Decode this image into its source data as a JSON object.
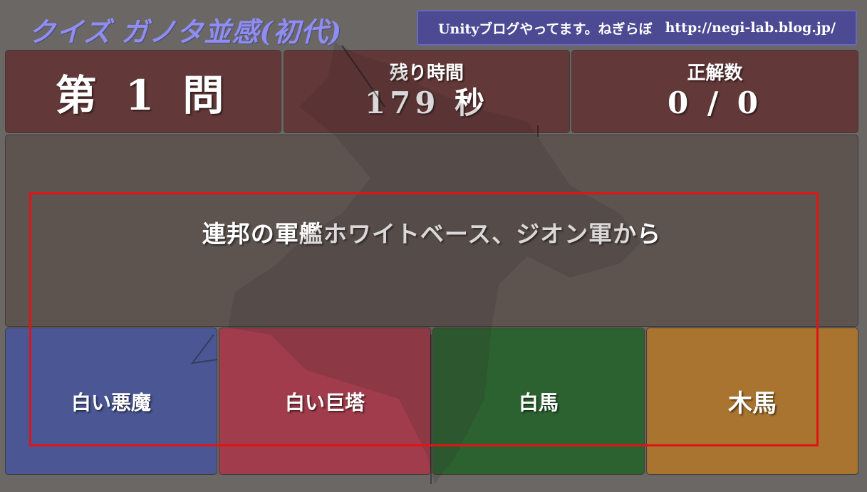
{
  "header": {
    "title": "クイズ ガノタ並感(初代)",
    "blog_text": "Unityブログやってます。ねぎらぼ",
    "blog_url": "http://negi-lab.blog.jp/"
  },
  "stats": {
    "question_number": "第 1 問",
    "time_label": "残り時間",
    "time_value": "179 秒",
    "score_label": "正解数",
    "score_value": "0 / 0"
  },
  "question": {
    "text": "連邦の軍艦ホワイトベース、ジオン軍から"
  },
  "answers": [
    {
      "label": "白い悪魔",
      "color": "#4a5794"
    },
    {
      "label": "白い巨塔",
      "color": "#a03c4c"
    },
    {
      "label": "白馬",
      "color": "#2c6230"
    },
    {
      "label": "木馬",
      "color": "#a9742f"
    }
  ],
  "colors": {
    "background": "#6a6764",
    "stat_panel": "#633838",
    "question_panel": "#5d5450",
    "title": "#8f8ef0",
    "banner": "#4c4a93",
    "highlight": "#e01414"
  }
}
